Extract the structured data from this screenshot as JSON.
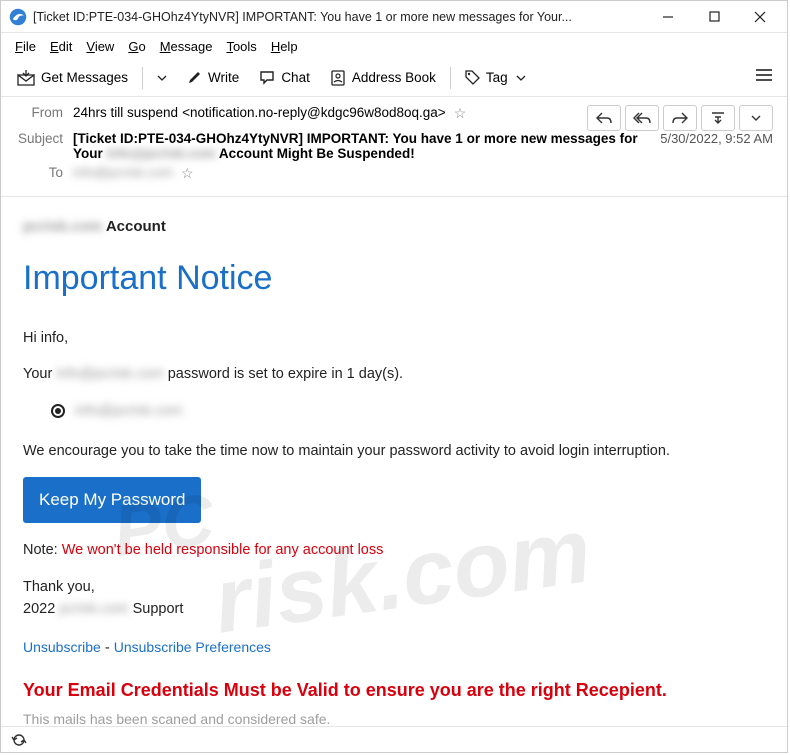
{
  "window": {
    "title": "[Ticket ID:PTE-034-GHOhz4YtyNVR] IMPORTANT: You have 1 or more new messages for Your..."
  },
  "menu": {
    "file": "File",
    "edit": "Edit",
    "view": "View",
    "go": "Go",
    "message": "Message",
    "tools": "Tools",
    "help": "Help"
  },
  "toolbar": {
    "get_messages": "Get Messages",
    "write": "Write",
    "chat": "Chat",
    "address_book": "Address Book",
    "tag": "Tag"
  },
  "headers": {
    "from_label": "From",
    "from_name": "24hrs till suspend",
    "from_addr": "<notification.no-reply@kdgc96w8od8oq.ga>",
    "subject_label": "Subject",
    "subject": "[Ticket ID:PTE-034-GHOhz4YtyNVR] IMPORTANT: You have 1 or more new messages for Your ██████████ Account Might Be Suspended!",
    "to_label": "To",
    "to_blur": "info@pcrisk.com",
    "datetime": "5/30/2022, 9:52 AM"
  },
  "body": {
    "account_line_suffix": " Account",
    "title": "Important Notice",
    "greeting": "Hi info,",
    "line1_prefix": "Your ",
    "line1_suffix": " password is set to expire in 1 day(s).",
    "bullet_blur": "info@pcrisk.com",
    "encourage": "We encourage you to take the time now to maintain your password activity to avoid login interruption.",
    "cta": "Keep My Password",
    "note_label": "Note:  ",
    "note_red": "We won't be held responsible for any account loss",
    "thank": "Thank you,",
    "signoff_year": "2022 ",
    "signoff_support": " Support",
    "unsubscribe": "Unsubscribe",
    "dash": " -   ",
    "unsub_prefs": "Unsubscribe Preferences",
    "warning": "Your Email Credentials Must be Valid to ensure you are the right Recepient.",
    "safe": "This mails has been scaned and considered safe."
  },
  "blur": {
    "domain": "pcrisk.com",
    "email": "info@pcrisk.com"
  }
}
